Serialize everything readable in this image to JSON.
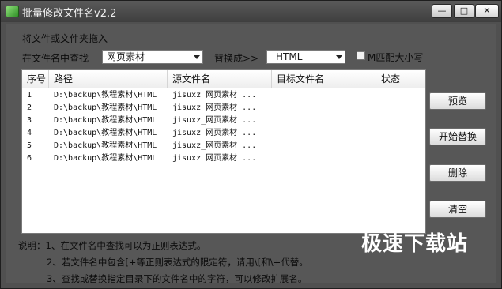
{
  "window": {
    "title": "批量修改文件名v2.2",
    "minimize_glyph": "—",
    "maximize_glyph": "□",
    "close_glyph": "✕"
  },
  "form": {
    "drop_hint": "将文件或文件夹拖入",
    "find_label": "在文件名中查找",
    "find_value": "网页素材",
    "replace_label": "替换成>>",
    "replace_value": "_HTML_",
    "match_case_label": "M匹配大小写",
    "match_case_checked": false
  },
  "table": {
    "columns": [
      "序号",
      "路径",
      "源文件名",
      "目标文件名",
      "状态"
    ],
    "rows": [
      {
        "num": "1",
        "path": "D:\\backup\\教程素材\\HTML",
        "source": "jisuxz 网页素材 ...",
        "target": "",
        "status": ""
      },
      {
        "num": "2",
        "path": "D:\\backup\\教程素材\\HTML",
        "source": "jisuxz 网页素材 ...",
        "target": "",
        "status": ""
      },
      {
        "num": "3",
        "path": "D:\\backup\\教程素材\\HTML",
        "source": "jisuxz_网页素材 ...",
        "target": "",
        "status": ""
      },
      {
        "num": "4",
        "path": "D:\\backup\\教程素材\\HTML",
        "source": "jisuxz_网页素材 ...",
        "target": "",
        "status": ""
      },
      {
        "num": "5",
        "path": "D:\\backup\\教程素材\\HTML",
        "source": "jisuxz_网页素材 ...",
        "target": "",
        "status": ""
      },
      {
        "num": "6",
        "path": "D:\\backup\\教程素材\\HTML",
        "source": "jisuxz 网页素材 ...",
        "target": "",
        "status": ""
      }
    ]
  },
  "buttons": {
    "preview": "预览",
    "start": "开始替换",
    "delete": "删除",
    "clear": "清空"
  },
  "notes": {
    "line1": "说明：1、在文件名中查找可以为正则表达式。",
    "line2": "2、若文件名中包含[+等正则表达式的限定符，请用\\[和\\+代替。",
    "line3": "3、查找或替换指定目录下的文件名中的字符，可以修改扩展名。"
  },
  "watermark": "极速下载站"
}
